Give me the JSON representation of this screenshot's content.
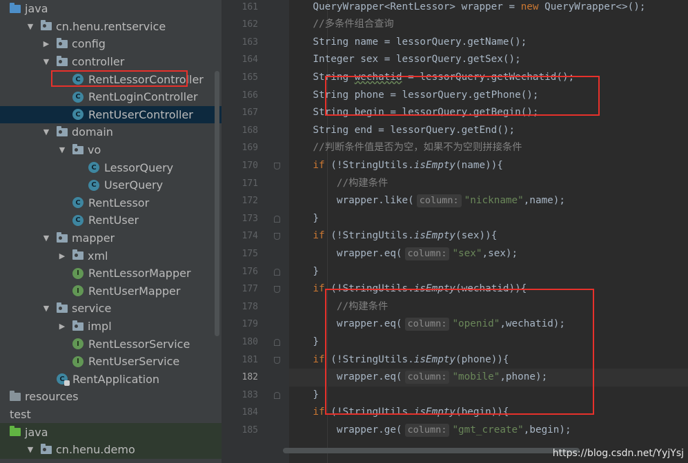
{
  "tree": {
    "items": [
      {
        "label": "java",
        "indent": 0,
        "arrow": "",
        "icon": "folder-blue",
        "selected": false
      },
      {
        "label": "cn.henu.rentservice",
        "indent": 1,
        "arrow": "down",
        "icon": "package",
        "selected": false
      },
      {
        "label": "config",
        "indent": 2,
        "arrow": "right",
        "icon": "package",
        "selected": false
      },
      {
        "label": "controller",
        "indent": 2,
        "arrow": "down",
        "icon": "package",
        "selected": false
      },
      {
        "label": "RentLessorController",
        "indent": 3,
        "arrow": "",
        "icon": "class",
        "selected": false
      },
      {
        "label": "RentLoginController",
        "indent": 3,
        "arrow": "",
        "icon": "class",
        "selected": false
      },
      {
        "label": "RentUserController",
        "indent": 3,
        "arrow": "",
        "icon": "class",
        "selected": true
      },
      {
        "label": "domain",
        "indent": 2,
        "arrow": "down",
        "icon": "package",
        "selected": false
      },
      {
        "label": "vo",
        "indent": 3,
        "arrow": "down",
        "icon": "package",
        "selected": false
      },
      {
        "label": "LessorQuery",
        "indent": 4,
        "arrow": "",
        "icon": "class",
        "selected": false
      },
      {
        "label": "UserQuery",
        "indent": 4,
        "arrow": "",
        "icon": "class",
        "selected": false
      },
      {
        "label": "RentLessor",
        "indent": 3,
        "arrow": "",
        "icon": "class",
        "selected": false
      },
      {
        "label": "RentUser",
        "indent": 3,
        "arrow": "",
        "icon": "class",
        "selected": false
      },
      {
        "label": "mapper",
        "indent": 2,
        "arrow": "down",
        "icon": "package",
        "selected": false
      },
      {
        "label": "xml",
        "indent": 3,
        "arrow": "right",
        "icon": "package",
        "selected": false
      },
      {
        "label": "RentLessorMapper",
        "indent": 3,
        "arrow": "",
        "icon": "interface",
        "selected": false
      },
      {
        "label": "RentUserMapper",
        "indent": 3,
        "arrow": "",
        "icon": "interface",
        "selected": false
      },
      {
        "label": "service",
        "indent": 2,
        "arrow": "down",
        "icon": "package",
        "selected": false
      },
      {
        "label": "impl",
        "indent": 3,
        "arrow": "right",
        "icon": "package",
        "selected": false
      },
      {
        "label": "RentLessorService",
        "indent": 3,
        "arrow": "",
        "icon": "interface",
        "selected": false
      },
      {
        "label": "RentUserService",
        "indent": 3,
        "arrow": "",
        "icon": "interface",
        "selected": false
      },
      {
        "label": "RentApplication",
        "indent": 2,
        "arrow": "",
        "icon": "app",
        "selected": false
      },
      {
        "label": "resources",
        "indent": 0,
        "arrow": "",
        "icon": "folder-res",
        "selected": false
      },
      {
        "label": "test",
        "indent": -1,
        "arrow": "",
        "icon": "none",
        "selected": false
      },
      {
        "label": "java",
        "indent": 0,
        "arrow": "",
        "icon": "folder-green",
        "selected": false,
        "green": true
      },
      {
        "label": "cn.henu.demo",
        "indent": 1,
        "arrow": "down",
        "icon": "package",
        "selected": false,
        "green": true
      }
    ]
  },
  "editor": {
    "current_line": 182,
    "lines": [
      {
        "n": 161,
        "tokens": [
          [
            "t",
            "    QueryWrapper<RentLessor> wrapper = "
          ],
          [
            "kw",
            "new "
          ],
          [
            "t",
            "QueryWrapper<>();"
          ]
        ]
      },
      {
        "n": 162,
        "tokens": [
          [
            "cm",
            "    //多条件组合查询"
          ]
        ]
      },
      {
        "n": 163,
        "tokens": [
          [
            "t",
            "    String name = lessorQuery.getName();"
          ]
        ]
      },
      {
        "n": 164,
        "tokens": [
          [
            "t",
            "    Integer sex = lessorQuery.getSex();"
          ]
        ]
      },
      {
        "n": 165,
        "tokens": [
          [
            "t",
            "    String "
          ],
          [
            "wavy",
            "wechatid"
          ],
          [
            "t",
            " = lessorQuery.getWechatid();"
          ]
        ]
      },
      {
        "n": 166,
        "tokens": [
          [
            "t",
            "    String phone = lessorQuery.getPhone();"
          ]
        ]
      },
      {
        "n": 167,
        "tokens": [
          [
            "t",
            "    String begin = lessorQuery.getBegin();"
          ]
        ]
      },
      {
        "n": 168,
        "tokens": [
          [
            "t",
            "    String end = lessorQuery.getEnd();"
          ]
        ]
      },
      {
        "n": 169,
        "tokens": [
          [
            "cm",
            "    //判断条件值是否为空，如果不为空则拼接条件"
          ]
        ]
      },
      {
        "n": 170,
        "tokens": [
          [
            "kw",
            "    if "
          ],
          [
            "t",
            "(!StringUtils."
          ],
          [
            "it",
            "isEmpty"
          ],
          [
            "t",
            "(name)){"
          ]
        ]
      },
      {
        "n": 171,
        "tokens": [
          [
            "cm",
            "        //构建条件"
          ]
        ]
      },
      {
        "n": 172,
        "tokens": [
          [
            "t",
            "        wrapper.like("
          ],
          [
            "hint",
            "column:"
          ],
          [
            "str",
            "\"nickname\""
          ],
          [
            "t",
            ",name);"
          ]
        ]
      },
      {
        "n": 173,
        "tokens": [
          [
            "t",
            "    }"
          ]
        ]
      },
      {
        "n": 174,
        "tokens": [
          [
            "kw",
            "    if "
          ],
          [
            "t",
            "(!StringUtils."
          ],
          [
            "it",
            "isEmpty"
          ],
          [
            "t",
            "(sex)){"
          ]
        ]
      },
      {
        "n": 175,
        "tokens": [
          [
            "t",
            "        wrapper.eq("
          ],
          [
            "hint",
            "column:"
          ],
          [
            "str",
            "\"sex\""
          ],
          [
            "t",
            ",sex);"
          ]
        ]
      },
      {
        "n": 176,
        "tokens": [
          [
            "t",
            "    }"
          ]
        ]
      },
      {
        "n": 177,
        "tokens": [
          [
            "kw",
            "    if "
          ],
          [
            "t",
            "(!StringUtils."
          ],
          [
            "it",
            "isEmpty"
          ],
          [
            "t",
            "(wechatid)){"
          ]
        ]
      },
      {
        "n": 178,
        "tokens": [
          [
            "cm",
            "        //构建条件"
          ]
        ]
      },
      {
        "n": 179,
        "tokens": [
          [
            "t",
            "        wrapper.eq("
          ],
          [
            "hint",
            "column:"
          ],
          [
            "str",
            "\"openid\""
          ],
          [
            "t",
            ",wechatid);"
          ]
        ]
      },
      {
        "n": 180,
        "tokens": [
          [
            "t",
            "    }"
          ]
        ]
      },
      {
        "n": 181,
        "tokens": [
          [
            "kw",
            "    if "
          ],
          [
            "t",
            "(!StringUtils."
          ],
          [
            "it",
            "isEmpty"
          ],
          [
            "t",
            "(phone)){"
          ]
        ]
      },
      {
        "n": 182,
        "tokens": [
          [
            "t",
            "        wrapper.eq("
          ],
          [
            "hint",
            "column:"
          ],
          [
            "str",
            "\"mobile\""
          ],
          [
            "t",
            ",phone);"
          ]
        ]
      },
      {
        "n": 183,
        "tokens": [
          [
            "t",
            "    }"
          ]
        ]
      },
      {
        "n": 184,
        "tokens": [
          [
            "kw",
            "    if "
          ],
          [
            "t",
            "(!StringUtils."
          ],
          [
            "it",
            "isEmpty"
          ],
          [
            "t",
            "(begin)){"
          ]
        ]
      },
      {
        "n": 185,
        "tokens": [
          [
            "t",
            "        wrapper.ge("
          ],
          [
            "hint",
            "column:"
          ],
          [
            "str",
            "\"gmt_create\""
          ],
          [
            "t",
            ",begin);"
          ]
        ]
      }
    ]
  },
  "watermark": "https://blog.csdn.net/YyjYsj",
  "colors": {
    "highlight_box": "#e8312b",
    "keyword": "#cc7832",
    "string": "#6a8759",
    "comment": "#808080",
    "text": "#a9b7c6"
  }
}
